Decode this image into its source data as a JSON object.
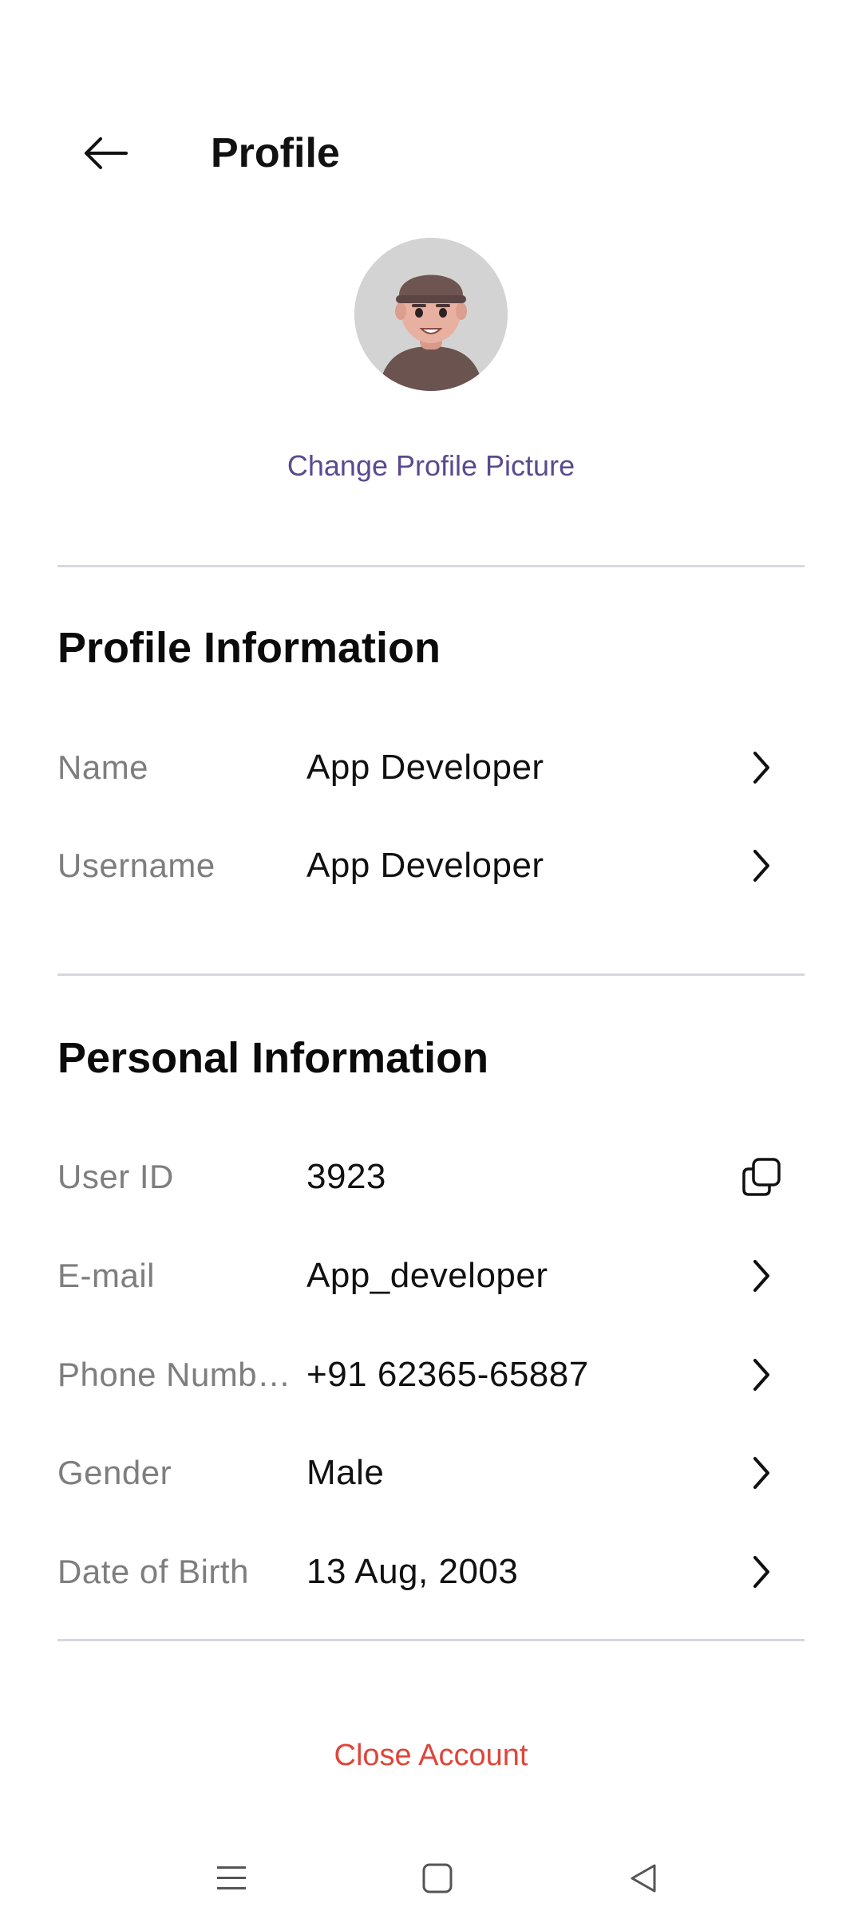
{
  "header": {
    "title": "Profile",
    "back_icon": "arrow-left-icon"
  },
  "profile": {
    "change_picture_label": "Change Profile Picture"
  },
  "profile_information": {
    "title": "Profile Information",
    "rows": [
      {
        "label": "Name",
        "value": "App Developer",
        "icon": "chevron-right-icon"
      },
      {
        "label": "Username",
        "value": "App Developer",
        "icon": "chevron-right-icon"
      }
    ]
  },
  "personal_information": {
    "title": "Personal Information",
    "rows": [
      {
        "label": "User ID",
        "value": "3923",
        "icon": "copy-icon"
      },
      {
        "label": "E-mail",
        "value": "App_developer",
        "icon": "chevron-right-icon"
      },
      {
        "label": "Phone Numb…",
        "value": "+91 62365-65887",
        "icon": "chevron-right-icon"
      },
      {
        "label": "Gender",
        "value": "Male",
        "icon": "chevron-right-icon"
      },
      {
        "label": "Date of Birth",
        "value": "13 Aug, 2003",
        "icon": "chevron-right-icon"
      }
    ]
  },
  "footer": {
    "close_account_label": "Close Account"
  },
  "system_nav": {
    "menu_icon": "menu-icon",
    "home_icon": "home-square-icon",
    "back_icon": "triangle-back-icon"
  },
  "colors": {
    "accent_link": "#5a4a8f",
    "danger": "#e0453a",
    "label_gray": "#7e7e7e",
    "divider": "#d9d6e0"
  }
}
